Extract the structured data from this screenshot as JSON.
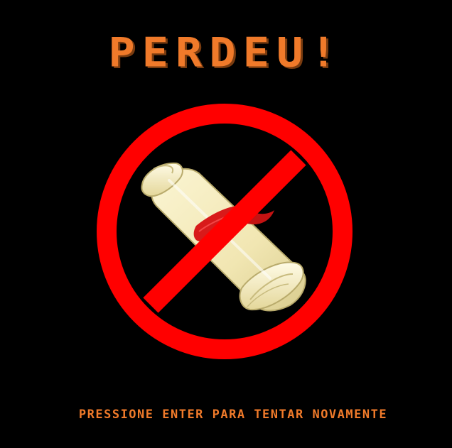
{
  "screen": {
    "title": "PERDEU!",
    "prompt": "PRESSIONE ENTER PARA TENTAR NOVAMENTE"
  },
  "illustration": {
    "icon": "prohibited-scroll-icon",
    "symbol": "no-entry-sign-icon",
    "object": "paper-scroll-icon"
  },
  "colors": {
    "background": "#000000",
    "text": "#f07a2a",
    "prohibition": "#ff0000",
    "scroll": "#f3eab8",
    "ribbon": "#d81a1a"
  }
}
